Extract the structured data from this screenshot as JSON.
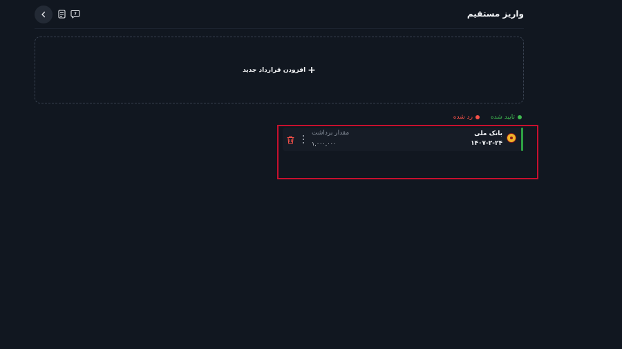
{
  "header": {
    "title": "واریز مستقیم",
    "icons": [
      "chevron-left-icon",
      "receipt-icon",
      "help-chat-icon"
    ]
  },
  "add_contract": {
    "plus": "+",
    "label": "افزودن قرارداد جدید"
  },
  "legend": {
    "approved": {
      "label": "تایید شده",
      "color": "#3fb950"
    },
    "rejected": {
      "label": "رد شده",
      "color": "#f85149"
    }
  },
  "contracts": [
    {
      "bank_name": "بانک ملی",
      "date": "۱۴۰۷-۲-۲۴",
      "amount_label": "مقدار برداشت",
      "amount_value": "۱,۰۰۰,۰۰۰",
      "status": "approved"
    }
  ]
}
